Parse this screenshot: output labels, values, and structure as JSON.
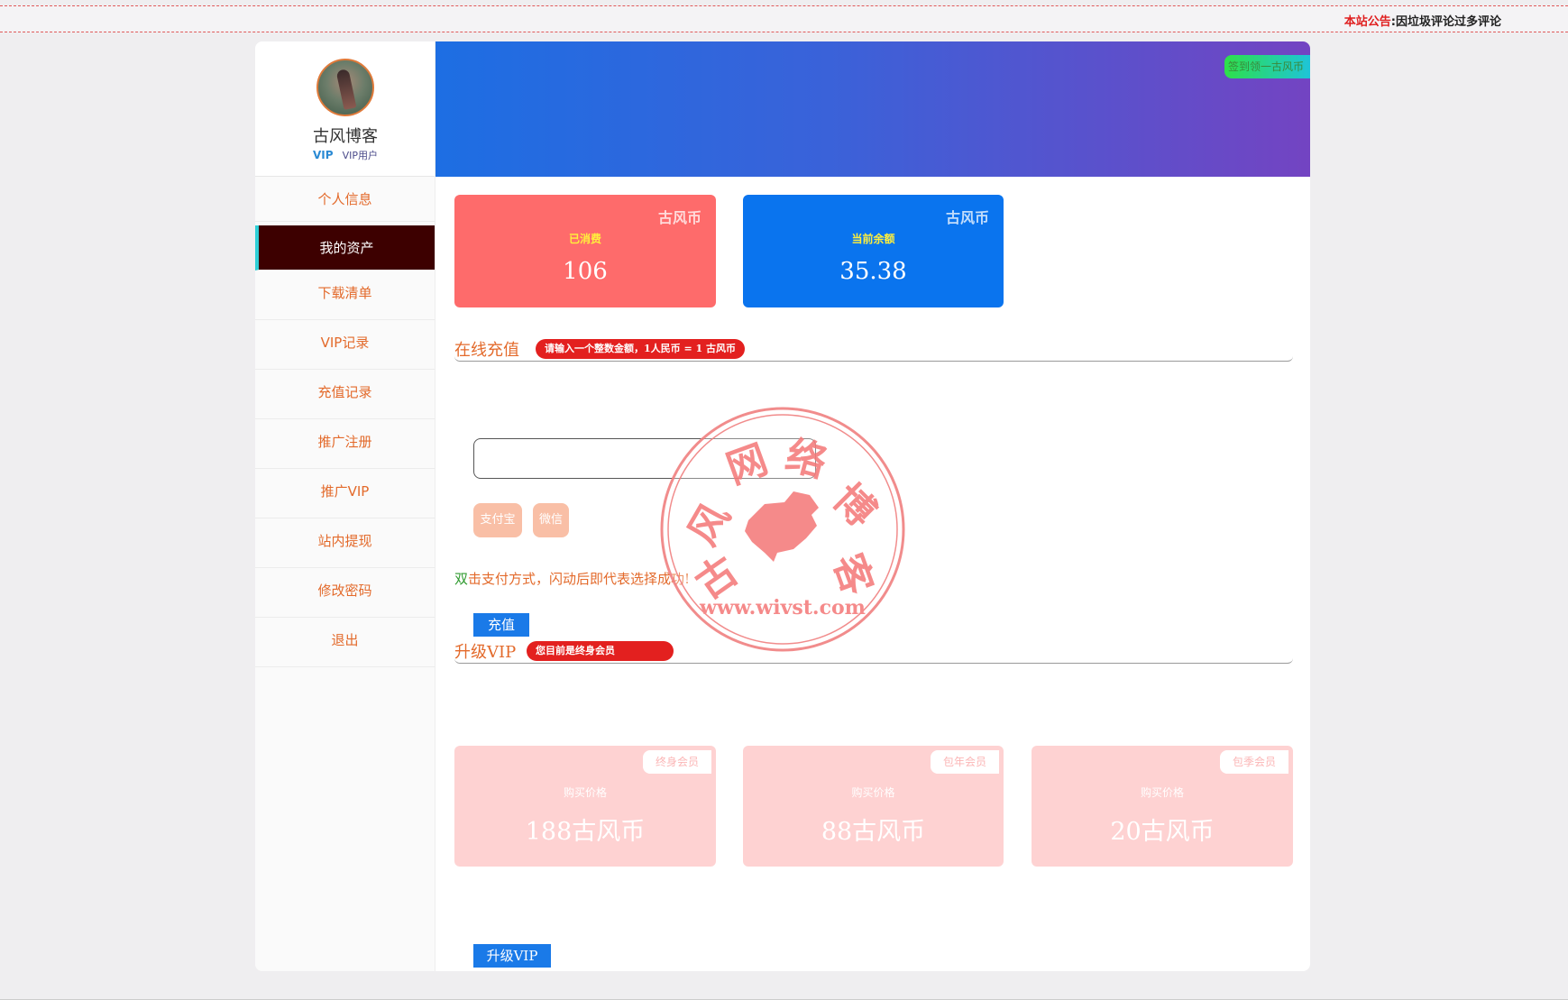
{
  "notice": {
    "label": "本站公告",
    "separator": ":",
    "text": "因垃圾评论过多评论"
  },
  "profile": {
    "name": "古风博客",
    "vip_icon_text": "VIP",
    "vip_label": "VIP用户"
  },
  "menu": [
    {
      "label": "个人信息",
      "active": false
    },
    {
      "label": "我的资产",
      "active": true
    },
    {
      "label": "下载清单",
      "active": false
    },
    {
      "label": "VIP记录",
      "active": false
    },
    {
      "label": "充值记录",
      "active": false
    },
    {
      "label": "推广注册",
      "active": false
    },
    {
      "label": "推广VIP",
      "active": false
    },
    {
      "label": "站内提现",
      "active": false
    },
    {
      "label": "修改密码",
      "active": false
    },
    {
      "label": "退出",
      "active": false
    }
  ],
  "banner": {
    "signin_label": "签到领一古风币"
  },
  "assets": {
    "consumed": {
      "unit": "古风币",
      "label": "已消费",
      "value": "106"
    },
    "balance": {
      "unit": "古风币",
      "label": "当前余额",
      "value": "35.38"
    }
  },
  "recharge": {
    "title": "在线充值",
    "badge": "请输入一个整数金额，1人民币 = 1 古风币",
    "input_value": "",
    "pay_alipay": "支付宝",
    "pay_wechat": "微信",
    "hint_prefix": "双",
    "hint_rest": "击支付方式，闪动后即代表选择成功!",
    "submit_label": "充值"
  },
  "vip": {
    "title": "升级VIP",
    "badge": "您目前是终身会员",
    "plans": [
      {
        "tag": "终身会员",
        "label": "购买价格",
        "price": "188古风币"
      },
      {
        "tag": "包年会员",
        "label": "购买价格",
        "price": "88古风币"
      },
      {
        "tag": "包季会员",
        "label": "购买价格",
        "price": "20古风币"
      }
    ],
    "upgrade_label": "升级VIP"
  },
  "watermark": {
    "text": "www.wivst.com",
    "chars": [
      "古",
      "风",
      "网",
      "络",
      "博",
      "客"
    ]
  },
  "colors": {
    "accent_orange": "#e36a2b",
    "consumed_card": "#fe6b6b",
    "balance_card": "#0a74ee",
    "active_menu": "#3d0000",
    "badge_red": "#e3201f",
    "button_blue": "#1a7ae8"
  }
}
